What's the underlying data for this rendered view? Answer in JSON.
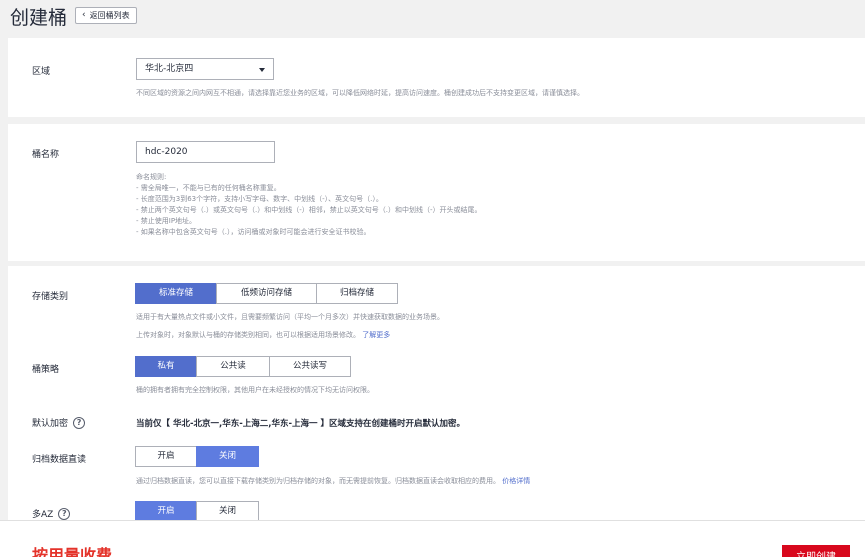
{
  "header": {
    "title": "创建桶",
    "back_label": "返回桶列表"
  },
  "region": {
    "label": "区域",
    "selected": "华北-北京四",
    "hint": "不同区域的资源之间内网互不相通，请选择靠近您业务的区域，可以降低网络时延，提高访问速度。桶创建成功后不支持变更区域，请谨慎选择。"
  },
  "bucket_name": {
    "label": "桶名称",
    "value": "hdc-2020",
    "rules": [
      "命名规则:",
      "- 需全局唯一，不能与已有的任何桶名称重复。",
      "- 长度范围为3到63个字符，支持小写字母、数字、中划线（-）、英文句号（.）。",
      "- 禁止两个英文句号（.）或英文句号（.）和中划线（-）相邻，禁止以英文句号（.）和中划线（-）开头或结尾。",
      "- 禁止使用IP地址。",
      "- 如果名称中包含英文句号（.），访问桶或对象时可能会进行安全证书校验。"
    ]
  },
  "storage_class": {
    "label": "存储类别",
    "options": [
      "标准存储",
      "低频访问存储",
      "归档存储"
    ],
    "selected": "标准存储",
    "hint1": "适用于有大量热点文件或小文件，且需要频繁访问（平均一个月多次）并快速获取数据的业务场景。",
    "hint2": "上传对象时，对象默认与桶的存储类别相同，也可以根据适用场景修改。",
    "learn_more": "了解更多"
  },
  "bucket_policy": {
    "label": "桶策略",
    "options": [
      "私有",
      "公共读",
      "公共读写"
    ],
    "selected": "私有",
    "hint": "桶的拥有者拥有完全控制权限，其他用户在未经授权的情况下均无访问权限。"
  },
  "encryption": {
    "label": "默认加密",
    "note": "当前仅【 华北-北京一,华东-上海二,华东-上海一 】区域支持在创建桶时开启默认加密。"
  },
  "archive_direct_read": {
    "label": "归档数据直读",
    "options": [
      "开启",
      "关闭"
    ],
    "selected": "关闭",
    "hint": "通过归档数据直读，您可以直接下载存储类别为归档存储的对象，而无需提前恢复。归档数据直读会收取相应的费用。",
    "link": "价格详情"
  },
  "multi_az": {
    "label": "多AZ",
    "options": [
      "开启",
      "关闭"
    ],
    "selected": "开启"
  },
  "footer": {
    "billing": "按用量收费",
    "create_label": "立即创建"
  },
  "colors": {
    "accent": "#526ecc",
    "danger": "#d8081d",
    "billing_text": "#e4332a"
  }
}
